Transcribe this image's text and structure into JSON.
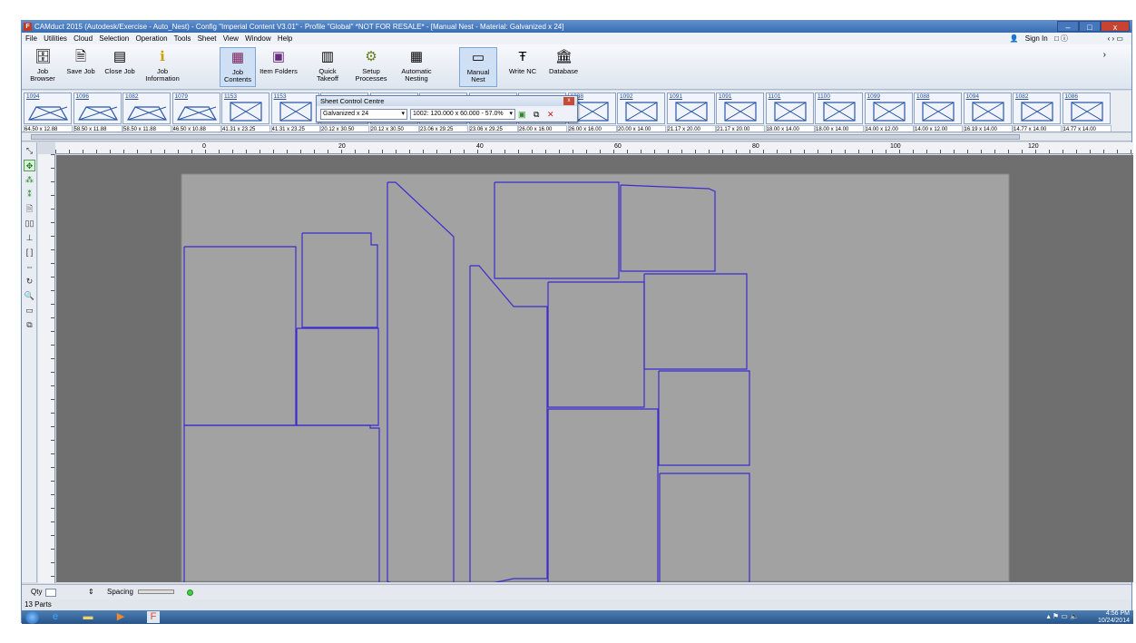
{
  "window": {
    "title": "CAMduct 2015 (Autodesk/Exercise - Auto_Nest) - Config \"Imperial Content V3.01\" - Profile \"Global\" *NOT FOR RESALE* - [Manual Nest - Material: Galvanized x 24]",
    "app_icon": "F",
    "buttons": [
      "–",
      "□",
      "x"
    ]
  },
  "menu": {
    "items": [
      "File",
      "Utilities",
      "Cloud",
      "Selection",
      "Operation",
      "Tools",
      "Sheet",
      "View",
      "Window",
      "Help"
    ],
    "sign_in": "Sign In"
  },
  "ribbon": {
    "buttons": [
      {
        "label": "Job Browser",
        "icon": "job-browser-icon"
      },
      {
        "label": "Save Job",
        "icon": "save-icon"
      },
      {
        "label": "Close Job",
        "icon": "close-job-icon"
      },
      {
        "label": "Job Information",
        "icon": "info-icon"
      },
      {
        "label": "Job Contents",
        "icon": "grid-icon",
        "active": true
      },
      {
        "label": "Item Folders",
        "icon": "folder-icon"
      },
      {
        "label": "Quick Takeoff",
        "icon": "takeoff-icon"
      },
      {
        "label": "Setup Processes",
        "icon": "gears-icon"
      },
      {
        "label": "Automatic Nesting",
        "icon": "nesting-icon"
      },
      {
        "label": "Manual Nest",
        "icon": "manual-nest-icon",
        "active": true
      },
      {
        "label": "Write NC",
        "icon": "write-nc-icon"
      },
      {
        "label": "Database",
        "icon": "database-icon"
      }
    ]
  },
  "parts": [
    {
      "num": "1094",
      "dim": "64.50 x 12.88"
    },
    {
      "num": "1096",
      "dim": "58.50 x 11.88"
    },
    {
      "num": "1082",
      "dim": "58.50 x 11.88"
    },
    {
      "num": "1079",
      "dim": "46.50 x 10.88"
    },
    {
      "num": "1153",
      "dim": "41.31 x 23.25"
    },
    {
      "num": "1153",
      "dim": "41.31 x 23.25"
    },
    {
      "num": "",
      "dim": "20.12 x 30.50"
    },
    {
      "num": "",
      "dim": "20.12 x 30.50"
    },
    {
      "num": "",
      "dim": "23.06 x 29.25"
    },
    {
      "num": "",
      "dim": "23.06 x 29.25"
    },
    {
      "num": "",
      "dim": "26.00 x 16.00"
    },
    {
      "num": "1088",
      "dim": "26.00 x 16.00"
    },
    {
      "num": "1092",
      "dim": "20.00 x 14.00"
    },
    {
      "num": "1091",
      "dim": "21.17 x 20.00"
    },
    {
      "num": "1091",
      "dim": "21.17 x 20.00"
    },
    {
      "num": "1101",
      "dim": "18.00 x 14.00"
    },
    {
      "num": "1100",
      "dim": "18.00 x 14.00"
    },
    {
      "num": "1099",
      "dim": "14.00 x 12.00"
    },
    {
      "num": "1088",
      "dim": "14.00 x 12.00"
    },
    {
      "num": "1094",
      "dim": "16.19 x 14.00"
    },
    {
      "num": "1082",
      "dim": "14.77 x 14.00"
    },
    {
      "num": "1086",
      "dim": "14.77 x 14.00"
    }
  ],
  "sheet_control": {
    "title": "Sheet Control Centre",
    "material": "Galvanized x 24",
    "sheet": "1002: 120.000 x 60.000 - 57.0%"
  },
  "ruler": {
    "x_labels": [
      "0",
      "20",
      "40",
      "60",
      "80",
      "100",
      "120"
    ]
  },
  "status": {
    "qty_label": "Qty",
    "spacing_label": "Spacing",
    "parts_count": "13 Parts"
  },
  "taskbar": {
    "time": "4:56 PM",
    "date": "10/24/2014"
  },
  "colors": {
    "sheet": "#a2a2a2",
    "part_outline": "#3b2ccf",
    "canvas_bg": "#6f6f6f"
  }
}
